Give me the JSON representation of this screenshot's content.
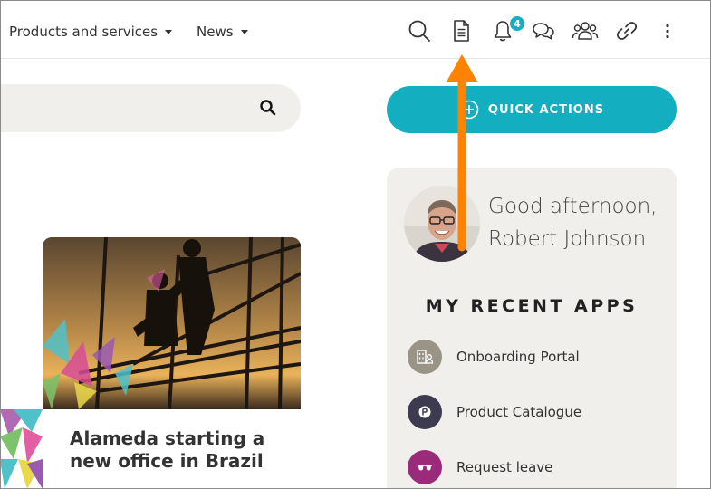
{
  "nav": {
    "items": [
      {
        "label": "Products and services"
      },
      {
        "label": "News"
      }
    ]
  },
  "toolbar": {
    "icons": [
      "search-icon",
      "document-icon",
      "bell-icon",
      "chat-icon",
      "people-icon",
      "link-icon",
      "more-icon"
    ],
    "notification_count": "4"
  },
  "quick_actions": {
    "label": "QUICK ACTIONS"
  },
  "news": {
    "title": "Alameda starting a new office in Brazil"
  },
  "profile": {
    "greeting_line1": "Good afternoon,",
    "greeting_line2": "Robert Johnson"
  },
  "recent_apps": {
    "title": "MY RECENT APPS",
    "items": [
      {
        "label": "Onboarding Portal",
        "icon": "building-person-icon",
        "color": "#9a9486"
      },
      {
        "label": "Product Catalogue",
        "icon": "p-circle-icon",
        "color": "#3d3b4f"
      },
      {
        "label": "Request leave",
        "icon": "sunglasses-icon",
        "color": "#9c2a7a"
      }
    ]
  },
  "colors": {
    "accent": "#13afc0",
    "badge": "#19aebf",
    "panel_bg": "#f1efec",
    "annotation_arrow": "#ff8200"
  }
}
